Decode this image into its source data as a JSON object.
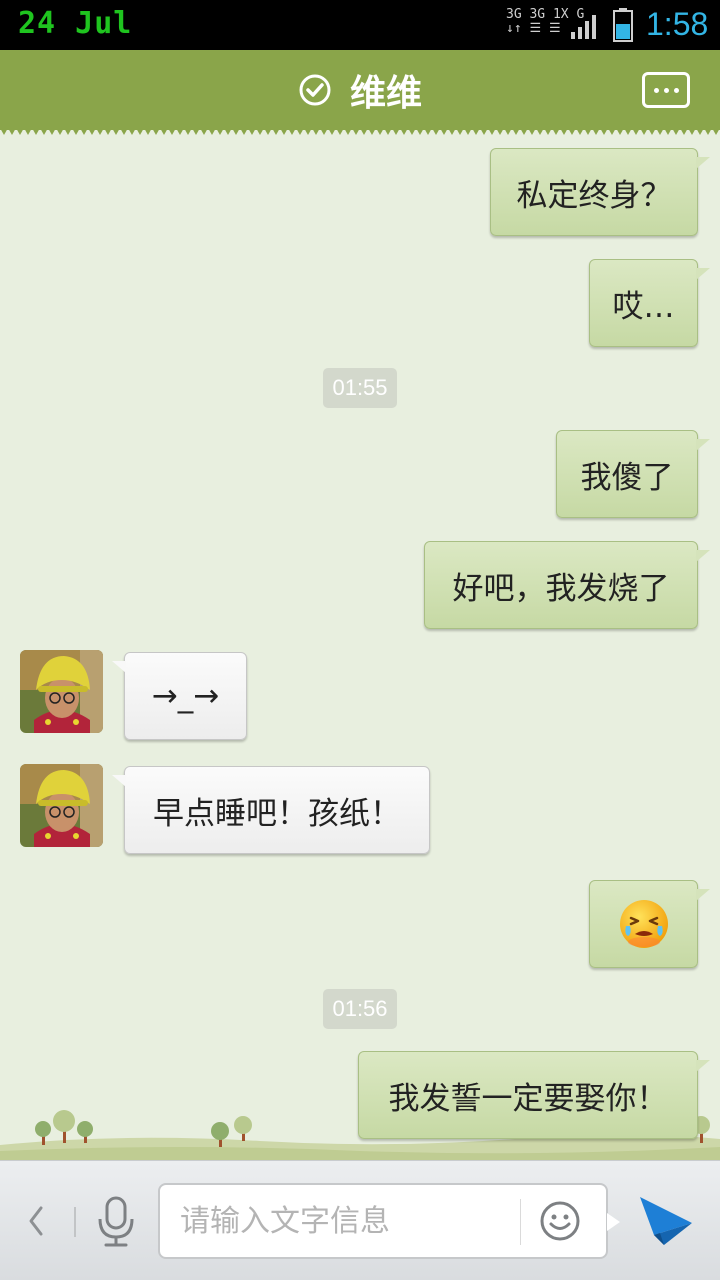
{
  "status_bar": {
    "date": "24 Jul",
    "network_top": "3G 3G 1X  G",
    "network_bottom": "↓↑ ☰ ☰",
    "time": "1:58"
  },
  "header": {
    "title": "维维",
    "verified_icon": "check-circle-icon",
    "more_icon": "more-dots-icon",
    "color": "#8aa54a"
  },
  "messages": [
    {
      "type": "out",
      "text": "私定终身？"
    },
    {
      "type": "out",
      "text": "哎…"
    },
    {
      "type": "time",
      "text": "01:55"
    },
    {
      "type": "out",
      "text": "我傻了"
    },
    {
      "type": "out",
      "text": "好吧，我发烧了"
    },
    {
      "type": "in",
      "text": "→_→"
    },
    {
      "type": "in",
      "text": "早点睡吧！孩纸！"
    },
    {
      "type": "out",
      "emoji": "crying-face-emoji"
    },
    {
      "type": "time",
      "text": "01:56"
    },
    {
      "type": "out",
      "text": "我发誓一定要娶你！"
    }
  ],
  "input_bar": {
    "placeholder": "请输入文字信息",
    "value": "",
    "back_icon": "chevron-left-icon",
    "mic_icon": "microphone-icon",
    "emoji_icon": "smiley-icon",
    "send_icon": "send-plane-icon"
  },
  "colors": {
    "out_bubble": "#cfe0b3",
    "in_bubble": "#f4f4f4",
    "chat_bg": "#e8efdf",
    "accent_time": "#33b5e5",
    "send": "#1e7fd6"
  }
}
